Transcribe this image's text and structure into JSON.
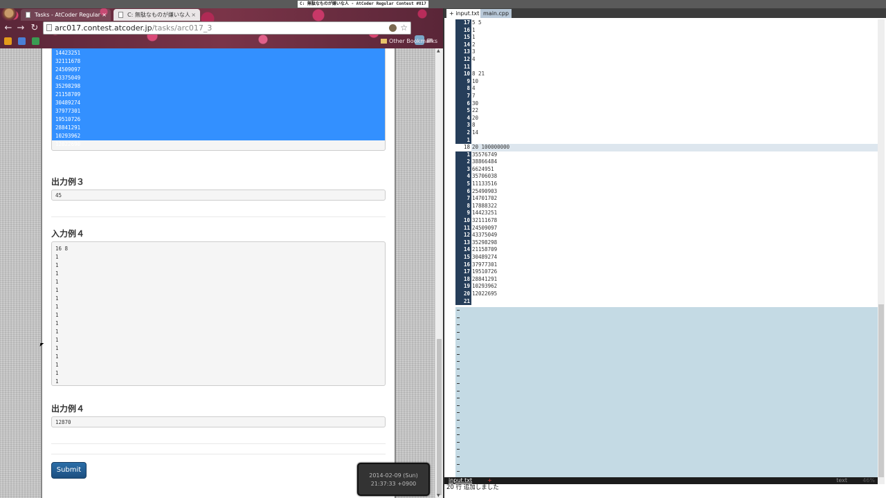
{
  "system": {
    "top_title": "C: 無駄なものが嫌いな人 - AtCoder Regular Contest #017"
  },
  "browser": {
    "tabs": [
      {
        "label": "Tasks - AtCoder Regular",
        "close": "×"
      },
      {
        "label": "C: 無駄なものが嫌いな人",
        "close": "×"
      }
    ],
    "omnibox": {
      "host": "arc017.contest.atcoder.jp",
      "path": "/tasks/arc017_3"
    },
    "nav": {
      "back": "←",
      "forward": "→",
      "reload": "↻"
    },
    "bookmarks": {
      "other": "Other Bookmarks"
    }
  },
  "page": {
    "selected_values": [
      "14423251",
      "32111678",
      "24509097",
      "43375049",
      "35298298",
      "21158709",
      "30489274",
      "37977301",
      "19510726",
      "28841291",
      "10293962",
      "12022690"
    ],
    "output3": {
      "heading": "出力例３",
      "value": "45"
    },
    "input4": {
      "heading": "入力例４",
      "lines": [
        "16 8",
        "1",
        "1",
        "1",
        "1",
        "1",
        "1",
        "1",
        "1",
        "1",
        "1",
        "1",
        "1",
        "1",
        "1",
        "1",
        "1"
      ]
    },
    "output4": {
      "heading": "出力例４",
      "value": "12870"
    },
    "submit_label": "Submit"
  },
  "clock": {
    "date": "2014-02-09 (Sun)",
    "time": "21:37:33 +0900"
  },
  "editor": {
    "tabs": [
      {
        "label": "+ input.txt"
      },
      {
        "label": "main.cpp"
      }
    ],
    "lines": [
      {
        "n": "17",
        "t": "5 5"
      },
      {
        "n": "16",
        "t": "1"
      },
      {
        "n": "15",
        "t": "1"
      },
      {
        "n": "14",
        "t": "2"
      },
      {
        "n": "13",
        "t": "3"
      },
      {
        "n": "12",
        "t": "4"
      },
      {
        "n": "11",
        "t": ""
      },
      {
        "n": "10",
        "t": "8 21"
      },
      {
        "n": "9",
        "t": "10"
      },
      {
        "n": "8",
        "t": "4"
      },
      {
        "n": "7",
        "t": "7"
      },
      {
        "n": "6",
        "t": "30"
      },
      {
        "n": "5",
        "t": "22"
      },
      {
        "n": "4",
        "t": "20"
      },
      {
        "n": "3",
        "t": "8"
      },
      {
        "n": "2",
        "t": "14"
      },
      {
        "n": "1",
        "t": ""
      },
      {
        "n": "18",
        "t": "20 100000000",
        "current": true
      },
      {
        "n": "1",
        "t": "35576749"
      },
      {
        "n": "2",
        "t": "38866484"
      },
      {
        "n": "3",
        "t": "6624951"
      },
      {
        "n": "4",
        "t": "35706038"
      },
      {
        "n": "5",
        "t": "11133516"
      },
      {
        "n": "6",
        "t": "25490903"
      },
      {
        "n": "7",
        "t": "14701702"
      },
      {
        "n": "8",
        "t": "17888322"
      },
      {
        "n": "9",
        "t": "14423251"
      },
      {
        "n": "10",
        "t": "32111678"
      },
      {
        "n": "11",
        "t": "24509097"
      },
      {
        "n": "12",
        "t": "43375049"
      },
      {
        "n": "13",
        "t": "35298298"
      },
      {
        "n": "14",
        "t": "21158709"
      },
      {
        "n": "15",
        "t": "30489274"
      },
      {
        "n": "16",
        "t": "37977301"
      },
      {
        "n": "17",
        "t": "19510726"
      },
      {
        "n": "18",
        "t": "28841291"
      },
      {
        "n": "19",
        "t": "10293962"
      },
      {
        "n": "20",
        "t": "12022695"
      },
      {
        "n": "21",
        "t": ""
      }
    ],
    "status": {
      "file": "input.txt",
      "modified": "+",
      "type": "text",
      "percent": "46%"
    },
    "cmdline": "20 行 追加しました"
  }
}
